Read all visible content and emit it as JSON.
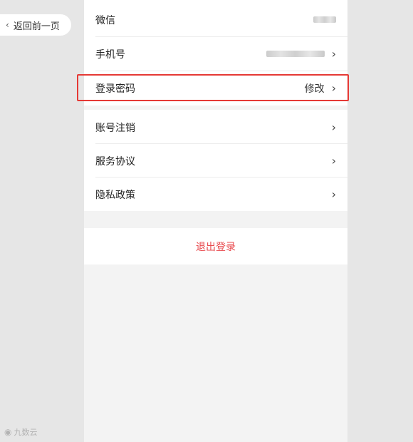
{
  "nav": {
    "back_label": "返回前一页",
    "back_icon": "chevron-left-icon"
  },
  "settings": {
    "group1": [
      {
        "label": "微信",
        "value_redacted": true
      },
      {
        "label": "手机号",
        "value_redacted": true,
        "has_chevron": true
      },
      {
        "label": "登录密码",
        "value": "修改",
        "has_chevron": true,
        "highlighted": true
      }
    ],
    "group2": [
      {
        "label": "账号注销",
        "has_chevron": true
      },
      {
        "label": "服务协议",
        "has_chevron": true
      },
      {
        "label": "隐私政策",
        "has_chevron": true
      }
    ],
    "chevron_glyph": "›"
  },
  "logout": {
    "label": "退出登录"
  },
  "watermark": {
    "text": "九数云",
    "icon": "weibo-icon"
  },
  "colors": {
    "highlight_border": "#e53935",
    "logout_text": "#e8474b",
    "page_background": "#e6e6e6",
    "panel_background": "#f3f3f3"
  }
}
